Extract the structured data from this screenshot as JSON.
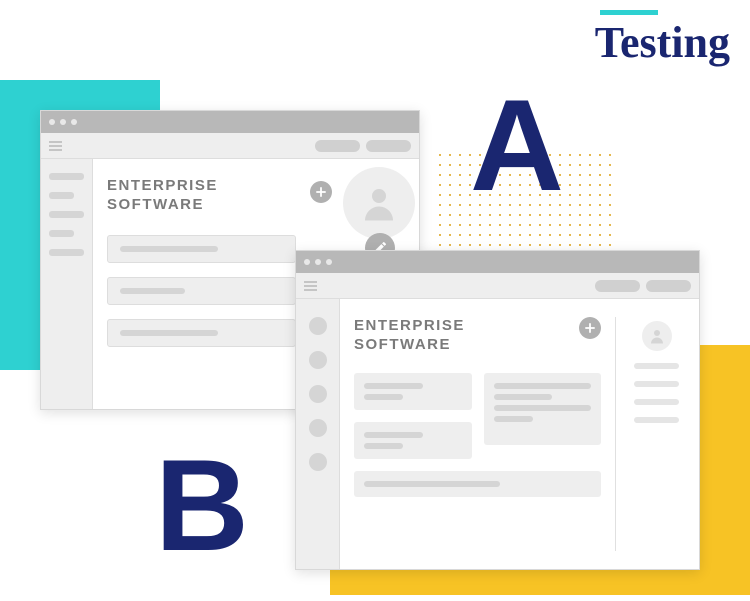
{
  "header": {
    "label": "Testing"
  },
  "labels": {
    "variant_a": "A",
    "variant_b": "B"
  },
  "window_a": {
    "title_line1": "ENTERPRISE",
    "title_line2": "SOFTWARE",
    "icons": {
      "add": "plus",
      "avatar": "user",
      "edit": "pencil"
    }
  },
  "window_b": {
    "title_line1": "ENTERPRISE",
    "title_line2": "SOFTWARE",
    "icons": {
      "add": "plus",
      "avatar": "user"
    }
  },
  "colors": {
    "accent_cyan": "#2ed1d1",
    "accent_yellow": "#f7c325",
    "brand_navy": "#1a2670"
  }
}
